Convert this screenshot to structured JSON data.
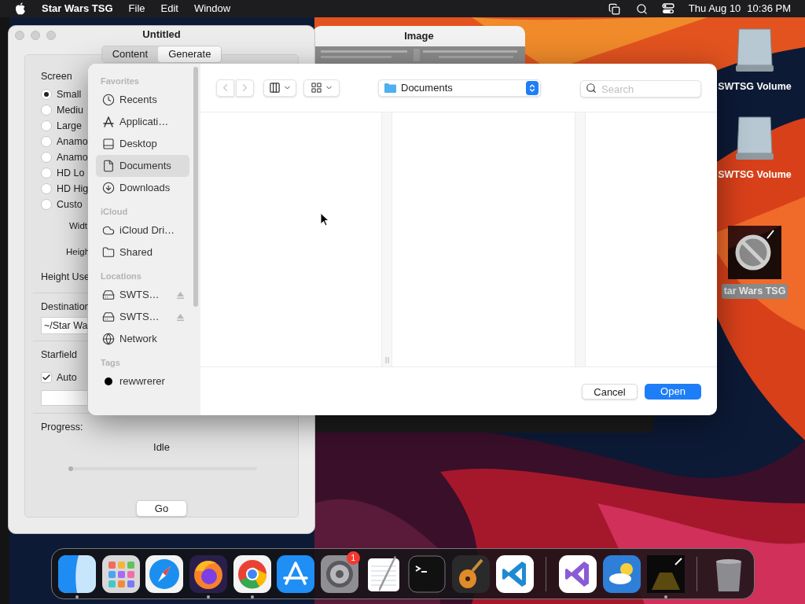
{
  "menu_bar": {
    "app_name": "Star Wars TSG",
    "menus": [
      "File",
      "Edit",
      "Window"
    ],
    "date": "Thu Aug 10",
    "time": "10:36 PM"
  },
  "desktop_icons": [
    {
      "kind": "drive",
      "label": "SWTSG Volume",
      "selected": false
    },
    {
      "kind": "drive",
      "label": "SWTSG Volume",
      "selected": false
    },
    {
      "kind": "app",
      "label": "tar Wars TSG",
      "selected": true
    }
  ],
  "main_window": {
    "title": "Untitled",
    "tabs": [
      {
        "label": "Content",
        "selected": false
      },
      {
        "label": "Generate",
        "selected": true
      }
    ],
    "screen_label": "Screen",
    "screen_options": [
      {
        "label": "Small",
        "selected": true
      },
      {
        "label": "Mediu",
        "selected": false
      },
      {
        "label": "Large",
        "selected": false
      },
      {
        "label": "Anamo",
        "selected": false
      },
      {
        "label": "Anamo",
        "selected": false
      },
      {
        "label": "HD Lo",
        "selected": false
      },
      {
        "label": "HD Hig",
        "selected": false
      },
      {
        "label": "Custo",
        "selected": false
      }
    ],
    "width_label": "Widt",
    "height_label": "Heigh",
    "height_used_label": "Height Use",
    "destination_label": "Destination",
    "destination_value": "~/Star Wa",
    "starfield_label": "Starfield",
    "auto": {
      "label": "Auto",
      "checked": true
    },
    "progress_label": "Progress:",
    "status": "Idle",
    "progress": {
      "level": 0
    },
    "go_button": "Go"
  },
  "image_window": {
    "title": "Image"
  },
  "open_dialog": {
    "sidebar": [
      {
        "heading": "Favorites",
        "items": [
          {
            "kind": "recents",
            "label": "Recents",
            "selected": false,
            "ejectable": false
          },
          {
            "kind": "applications",
            "label": "Applicati…",
            "selected": false,
            "ejectable": false
          },
          {
            "kind": "desktop",
            "label": "Desktop",
            "selected": false,
            "ejectable": false
          },
          {
            "kind": "documents",
            "label": "Documents",
            "selected": true,
            "ejectable": false
          },
          {
            "kind": "downloads",
            "label": "Downloads",
            "selected": false,
            "ejectable": false
          }
        ]
      },
      {
        "heading": "iCloud",
        "items": [
          {
            "kind": "cloud",
            "label": "iCloud Dri…",
            "selected": false,
            "ejectable": false
          },
          {
            "kind": "shared",
            "label": "Shared",
            "selected": false,
            "ejectable": false
          }
        ]
      },
      {
        "heading": "Locations",
        "items": [
          {
            "kind": "drive",
            "label": "SWTS…",
            "selected": false,
            "ejectable": true
          },
          {
            "kind": "drive",
            "label": "SWTS…",
            "selected": false,
            "ejectable": true
          },
          {
            "kind": "network",
            "label": "Network",
            "selected": false,
            "ejectable": false
          }
        ]
      },
      {
        "heading": "Tags",
        "items": [
          {
            "kind": "tag",
            "label": "rewwrerer",
            "selected": false,
            "ejectable": false,
            "color": "#000000"
          }
        ]
      }
    ],
    "location": "Documents",
    "search_placeholder": "Search",
    "cancel_button": "Cancel",
    "open_button": "Open"
  },
  "dock": {
    "sections": [
      [
        {
          "kind": "finder",
          "running": true
        },
        {
          "kind": "launchpad",
          "running": false
        },
        {
          "kind": "safari",
          "running": false
        },
        {
          "kind": "firefox",
          "running": true
        },
        {
          "kind": "chrome",
          "running": true
        },
        {
          "kind": "appstore",
          "running": false
        },
        {
          "kind": "settings",
          "running": false,
          "badge": "1"
        },
        {
          "kind": "textedit",
          "running": false
        },
        {
          "kind": "terminal",
          "running": false
        },
        {
          "kind": "guitar",
          "running": false
        },
        {
          "kind": "vscode",
          "running": false
        }
      ],
      [
        {
          "kind": "visualstudio",
          "running": false
        },
        {
          "kind": "weather",
          "running": false
        },
        {
          "kind": "starwars",
          "running": true
        }
      ],
      [
        {
          "kind": "trash",
          "running": false
        }
      ]
    ]
  }
}
